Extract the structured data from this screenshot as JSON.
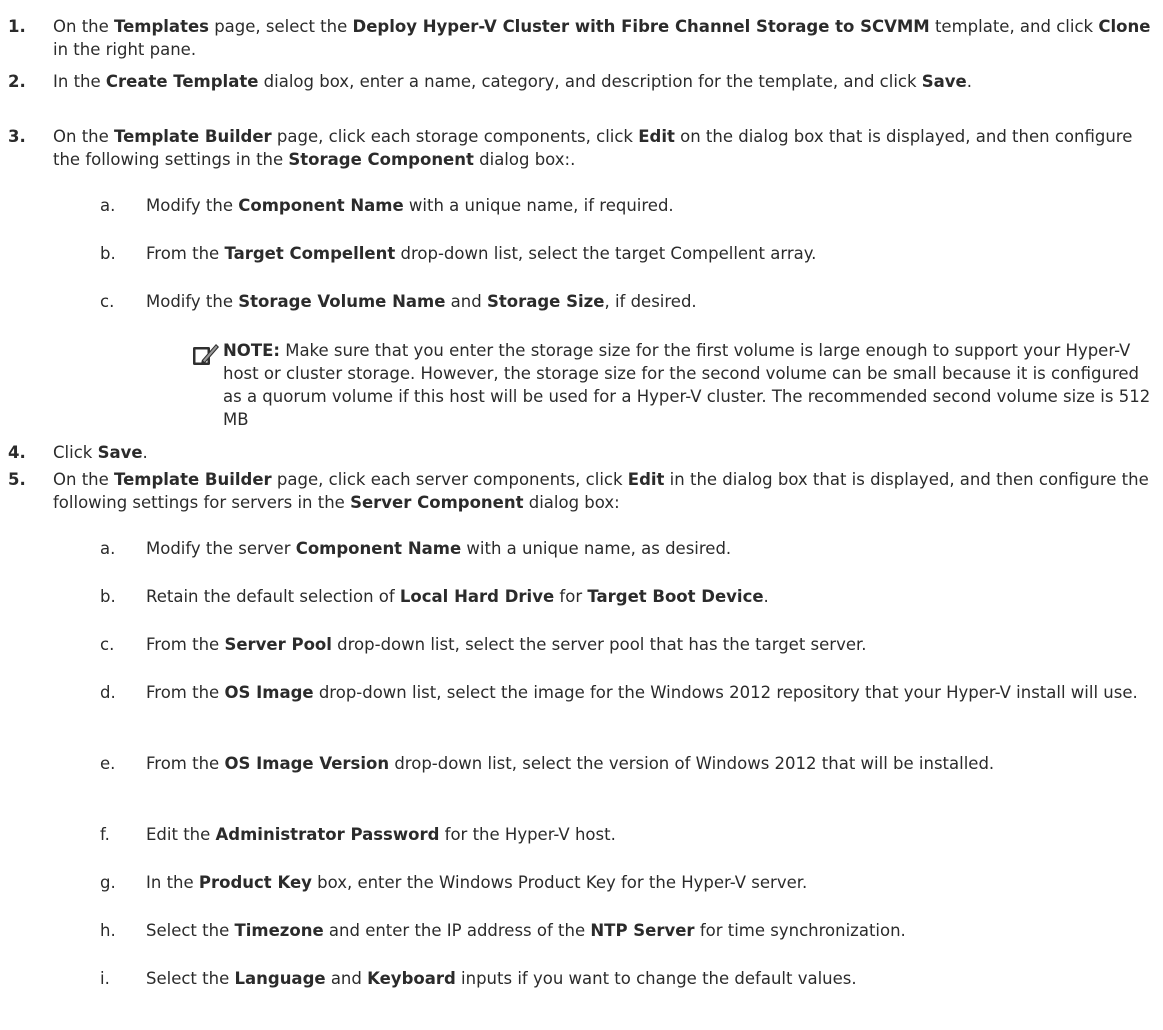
{
  "step1": {
    "num": "1.",
    "t1": "On the ",
    "b1": "Templates",
    "t2": " page, select the ",
    "b2": "Deploy Hyper-V Cluster with Fibre Channel Storage to SCVMM",
    "t3": " template, and click ",
    "b3": "Clone",
    "t4": " in the right pane."
  },
  "step2": {
    "num": "2.",
    "t1": "In the ",
    "b1": "Create Template",
    "t2": " dialog box, enter a name, category, and description for the template, and click ",
    "b2": "Save",
    "t3": "."
  },
  "step3": {
    "num": "3.",
    "t1": "On the ",
    "b1": "Template Builder",
    "t2": " page, click each storage components, click ",
    "b2": "Edit",
    "t3": " on the dialog box that is displayed, and then configure the following settings in the ",
    "b3": "Storage Component",
    "t4": " dialog box:."
  },
  "step3_subs": {
    "a": {
      "letter": "a.",
      "t1": "Modify the ",
      "b1": "Component Name",
      "t2": " with a unique name, if required."
    },
    "b": {
      "letter": "b.",
      "t1": "From the ",
      "b1": "Target Compellent",
      "t2": " drop-down list, select the target Compellent array."
    },
    "c": {
      "letter": "c.",
      "t1": "Modify the ",
      "b1": "Storage Volume Name",
      "t2": " and ",
      "b2": "Storage Size",
      "t3": ", if desired."
    }
  },
  "note": {
    "icon": "pencil-note-icon",
    "label": "NOTE:",
    "text": " Make sure that you enter the storage size for the first volume is large enough to support your Hyper-V host or cluster storage. However, the storage size for the second volume can be small because it is configured as a quorum volume if this host will be used for a Hyper-V cluster. The recommended second volume size is 512 MB"
  },
  "step4": {
    "num": "4.",
    "t1": "Click ",
    "b1": "Save",
    "t2": "."
  },
  "step5": {
    "num": "5.",
    "t1": "On the ",
    "b1": "Template Builder",
    "t2": " page, click each server components, click ",
    "b2": "Edit",
    "t3": " in the dialog box that is displayed, and then configure the following settings for servers in the ",
    "b3": "Server Component",
    "t4": " dialog box:"
  },
  "step5_subs": {
    "a": {
      "letter": "a.",
      "t1": "Modify the server ",
      "b1": "Component Name",
      "t2": " with a unique name, as desired."
    },
    "b": {
      "letter": "b.",
      "t1": "Retain the default selection of ",
      "b1": "Local Hard Drive",
      "t2": " for ",
      "b2": "Target Boot Device",
      "t3": "."
    },
    "c": {
      "letter": "c.",
      "t1": "From the ",
      "b1": "Server Pool",
      "t2": " drop-down list, select the server pool that has the target server."
    },
    "d": {
      "letter": "d.",
      "t1": "From the ",
      "b1": "OS Image",
      "t2": " drop-down list, select the image for the Windows 2012 repository that your Hyper-V install will use."
    },
    "e": {
      "letter": "e.",
      "t1": "From the ",
      "b1": "OS Image Version",
      "t2": " drop-down list, select the version of Windows 2012 that will be installed."
    },
    "f": {
      "letter": "f.",
      "t1": "Edit the ",
      "b1": "Administrator Password",
      "t2": " for the Hyper-V host."
    },
    "g": {
      "letter": "g.",
      "t1": "In the ",
      "b1": "Product Key",
      "t2": " box, enter the Windows Product Key for the Hyper-V server."
    },
    "h": {
      "letter": "h.",
      "t1": "Select the ",
      "b1": "Timezone",
      "t2": " and enter the IP address of the ",
      "b2": "NTP Server",
      "t3": " for time synchronization."
    },
    "i": {
      "letter": "i.",
      "t1": "Select the ",
      "b1": "Language",
      "t2": " and ",
      "b2": "Keyboard",
      "t3": " inputs if you want to change the default values."
    }
  }
}
